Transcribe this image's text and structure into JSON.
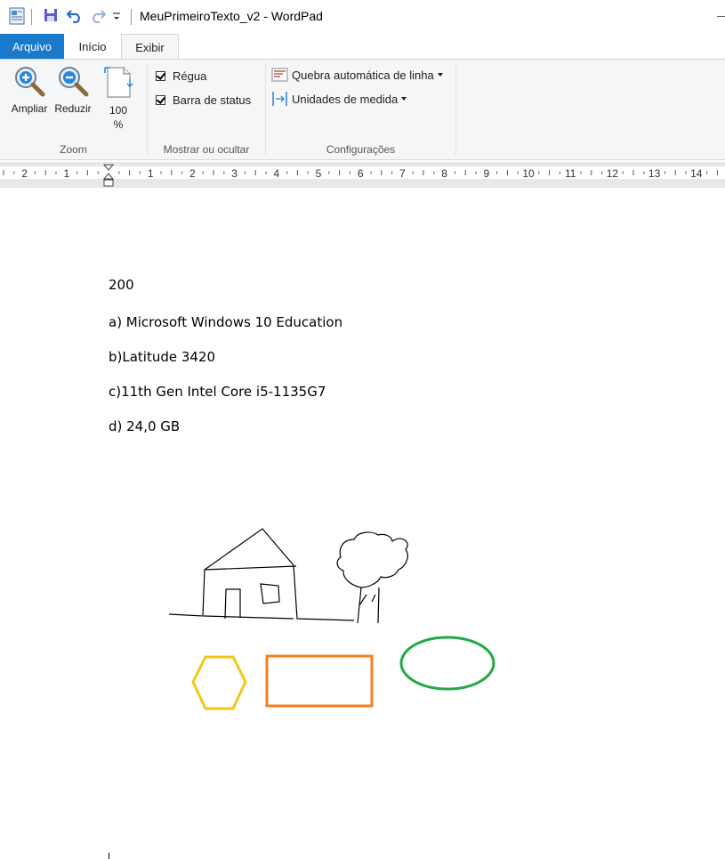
{
  "window": {
    "title": "MeuPrimeiroTexto_v2 - WordPad"
  },
  "quick_access": {
    "icons": [
      "wordpad-app-icon",
      "save-icon",
      "undo-icon",
      "redo-icon",
      "customize-dropdown-icon"
    ]
  },
  "tabs": [
    {
      "label": "Arquivo"
    },
    {
      "label": "Início"
    },
    {
      "label": "Exibir"
    }
  ],
  "ribbon": {
    "zoom": {
      "group_label": "Zoom",
      "zoom_in_label": "Ampliar",
      "zoom_out_label": "Reduzir",
      "hundred_label": "100",
      "hundred_label2": "%"
    },
    "show_hide": {
      "group_label": "Mostrar ou ocultar",
      "ruler_label": "Régua",
      "ruler_checked": true,
      "statusbar_label": "Barra de status",
      "statusbar_checked": true
    },
    "settings": {
      "group_label": "Configurações",
      "wordwrap_label": "Quebra automática de linha",
      "units_label": "Unidades de medida"
    }
  },
  "ruler": {
    "labels": [
      "2",
      "1",
      "1",
      "2",
      "3",
      "4",
      "5",
      "6",
      "7",
      "8",
      "9",
      "10",
      "11",
      "12",
      "13",
      "14"
    ]
  },
  "document": {
    "lines": [
      "200",
      "a) Microsoft Windows 10 Education",
      "b)Latitude  3420",
      "c)11th  Gen  Intel Core i5-1135G7",
      "d) 24,0 GB"
    ],
    "shapes": {
      "hexagon_color": "#f5c518",
      "rectangle_color": "#f28021",
      "ellipse_color": "#22a845",
      "sketch_color": "#000000"
    }
  },
  "colors": {
    "file_tab": "#1979ca",
    "ribbon_bg": "#f5f6f7"
  }
}
